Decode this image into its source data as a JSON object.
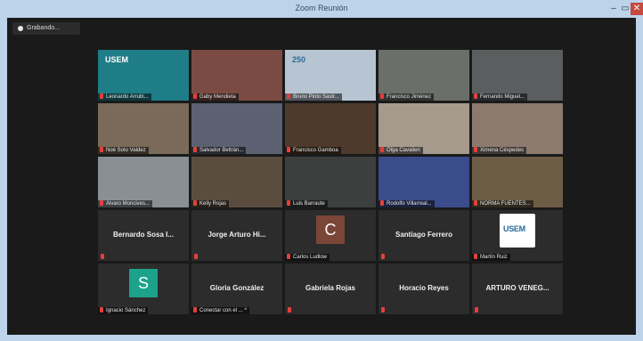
{
  "window": {
    "title": "Zoom Reunión",
    "min": "–",
    "max": "▭",
    "close": "✕"
  },
  "recording": {
    "label": "Grabando..."
  },
  "tiles": [
    {
      "id": "t1",
      "name": "Leonardo Arrubi...",
      "type": "video",
      "bg": "#1f7d87",
      "overlay": "USEM"
    },
    {
      "id": "t2",
      "name": "Gaby Mendieta",
      "type": "video",
      "bg": "#7b4b43"
    },
    {
      "id": "t3",
      "name": "Bruno Pinto Sastr...",
      "type": "video",
      "bg": "#b7c4d1",
      "overlay": "250"
    },
    {
      "id": "t4",
      "name": "Francisco Jiménez",
      "type": "video",
      "bg": "#6b6f6a"
    },
    {
      "id": "t5",
      "name": "Fernando Miguel...",
      "type": "video",
      "bg": "#5a5e5f",
      "active": true
    },
    {
      "id": "t6",
      "name": "Noé Soto Valdez",
      "type": "video",
      "bg": "#7a6a58"
    },
    {
      "id": "t7",
      "name": "Salvador Beltrán...",
      "type": "video",
      "bg": "#5b6170"
    },
    {
      "id": "t8",
      "name": "Francisco Gamboa",
      "type": "video",
      "bg": "#4e3a2c"
    },
    {
      "id": "t9",
      "name": "Olga Cavalieri",
      "type": "video",
      "bg": "#a69a8d"
    },
    {
      "id": "t10",
      "name": "Ximena Céspedes",
      "type": "video",
      "bg": "#8c7a6f"
    },
    {
      "id": "t11",
      "name": "Álvaro Moncives...",
      "type": "video",
      "bg": "#8a8f94"
    },
    {
      "id": "t12",
      "name": "Kelly Rojas",
      "type": "video",
      "bg": "#5a4d40"
    },
    {
      "id": "t13",
      "name": "Luis Barraute",
      "type": "video",
      "bg": "#3c3f3e"
    },
    {
      "id": "t14",
      "name": "Rodolfo Villarreal...",
      "type": "video",
      "bg": "#3a4d8a"
    },
    {
      "id": "t15",
      "name": "NORMA FUENTES...",
      "type": "video",
      "bg": "#6e5d46"
    },
    {
      "id": "t16",
      "name": "",
      "type": "name",
      "display": "Bernardo Sosa I..."
    },
    {
      "id": "t17",
      "name": "",
      "type": "name",
      "display": "Jorge Arturo Hi..."
    },
    {
      "id": "t18",
      "name": "Carlos Ludlow",
      "type": "avatar",
      "display": "C",
      "color": "#7a4638"
    },
    {
      "id": "t19",
      "name": "",
      "type": "name",
      "display": "Santiago Ferrero"
    },
    {
      "id": "t20",
      "name": "Martín Ruiz",
      "type": "logo",
      "display": "USEM"
    },
    {
      "id": "t21",
      "name": "Ignacio Sánchez",
      "type": "avatar",
      "display": "S",
      "color": "#1aa28b"
    },
    {
      "id": "t22",
      "name": "Conectar con el ... ^",
      "type": "name",
      "display": "Gloria González"
    },
    {
      "id": "t23",
      "name": "",
      "type": "name",
      "display": "Gabriela Rojas"
    },
    {
      "id": "t24",
      "name": "",
      "type": "name",
      "display": "Horacio Reyes"
    },
    {
      "id": "t25",
      "name": "",
      "type": "name",
      "display": "ARTURO VENEG..."
    }
  ]
}
